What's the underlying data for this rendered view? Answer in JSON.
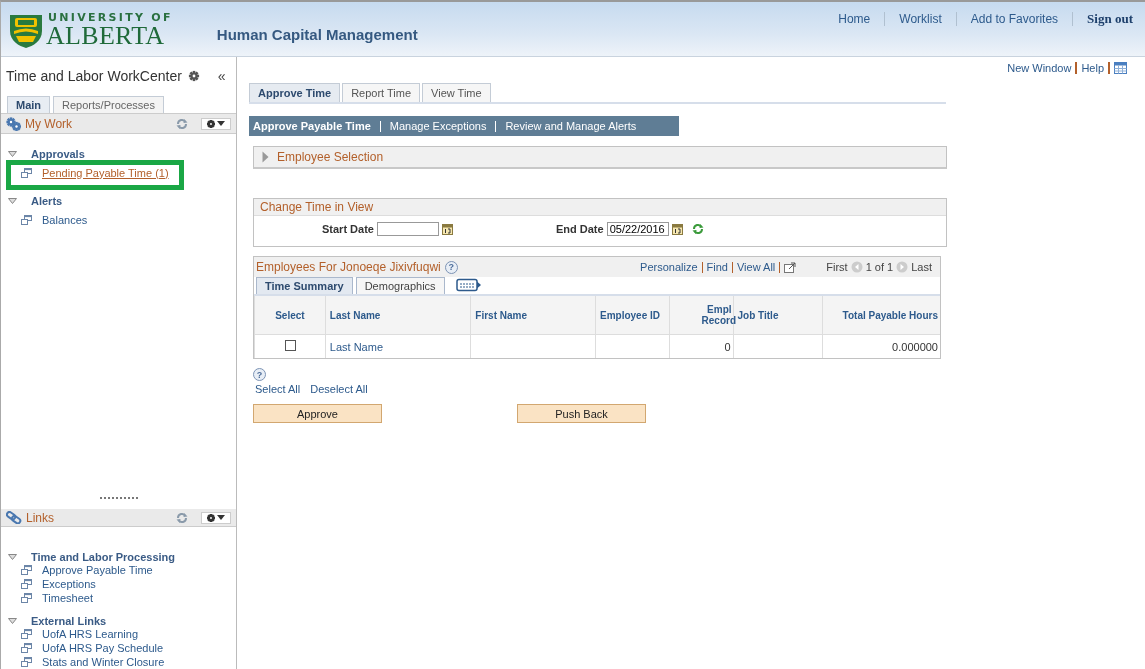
{
  "header": {
    "logo_top": "UNIVERSITY OF",
    "logo_bottom": "ALBERTA",
    "title": "Human Capital Management",
    "nav": [
      {
        "label": "Home",
        "kind": "link"
      },
      {
        "label": "Worklist",
        "kind": "link"
      },
      {
        "label": "Add to Favorites",
        "kind": "link"
      },
      {
        "label": "Sign out",
        "kind": "strong"
      }
    ]
  },
  "sidebar": {
    "title": "Time and Labor WorkCenter",
    "collapse": "«",
    "tabs": [
      {
        "label": "Main",
        "selected": true
      },
      {
        "label": "Reports/Processes",
        "selected": false
      }
    ],
    "pods": [
      {
        "title": "My Work",
        "sections": [
          {
            "label": "Approvals",
            "expanded": true,
            "items": [
              {
                "label": "Pending Payable Time (1)",
                "selected": true
              }
            ]
          },
          {
            "label": "Alerts",
            "expanded": true,
            "items": [
              {
                "label": "Balances",
                "selected": false
              }
            ]
          }
        ]
      },
      {
        "title": "Links",
        "sections": [
          {
            "label": "Time and Labor Processing",
            "expanded": true,
            "items": [
              {
                "label": "Approve Payable Time",
                "selected": false
              },
              {
                "label": "Exceptions",
                "selected": false
              },
              {
                "label": "Timesheet",
                "selected": false
              }
            ]
          },
          {
            "label": "External Links",
            "expanded": true,
            "items": [
              {
                "label": "UofA HRS Learning",
                "selected": false
              },
              {
                "label": "UofA HRS Pay Schedule",
                "selected": false
              },
              {
                "label": "Stats and Winter Closure",
                "selected": false
              }
            ]
          }
        ]
      }
    ]
  },
  "main": {
    "page_links": [
      "New Window",
      "Help"
    ],
    "tabs": [
      {
        "label": "Approve Time",
        "selected": true
      },
      {
        "label": "Report Time",
        "selected": false
      },
      {
        "label": "View Time",
        "selected": false
      }
    ],
    "subnav": [
      {
        "label": "Approve Payable Time",
        "selected": true
      },
      {
        "label": "Manage Exceptions",
        "selected": false
      },
      {
        "label": "Review and Manage Alerts",
        "selected": false
      }
    ],
    "employee_selection": {
      "label": "Employee Selection",
      "expanded": false
    },
    "change_time": {
      "title": "Change Time in View",
      "start_date": {
        "label": "Start Date"
      },
      "end_date": {
        "label": "End Date",
        "value": "05/22/2016"
      }
    },
    "grid": {
      "title": "Employees For Jonoeqe Jixivfuqwi",
      "help": "?",
      "links": [
        "Personalize",
        "Find",
        "View All"
      ],
      "pager": {
        "first": "First",
        "range": "1 of 1",
        "last": "Last"
      },
      "tabs": [
        {
          "label": "Time Summary",
          "selected": true
        },
        {
          "label": "Demographics",
          "selected": false
        }
      ],
      "columns": [
        "Select",
        "Last Name",
        "First Name",
        "Employee ID",
        "Empl Record",
        "Job Title",
        "Total Payable Hours"
      ],
      "rows": [
        {
          "checked": false,
          "last_name": "Last Name",
          "empl_record": "0",
          "total_payable_hours": "0.000000"
        }
      ]
    },
    "help": "?",
    "select_all": "Select All",
    "deselect_all": "Deselect All",
    "buttons": [
      "Approve",
      "Push Back"
    ]
  }
}
